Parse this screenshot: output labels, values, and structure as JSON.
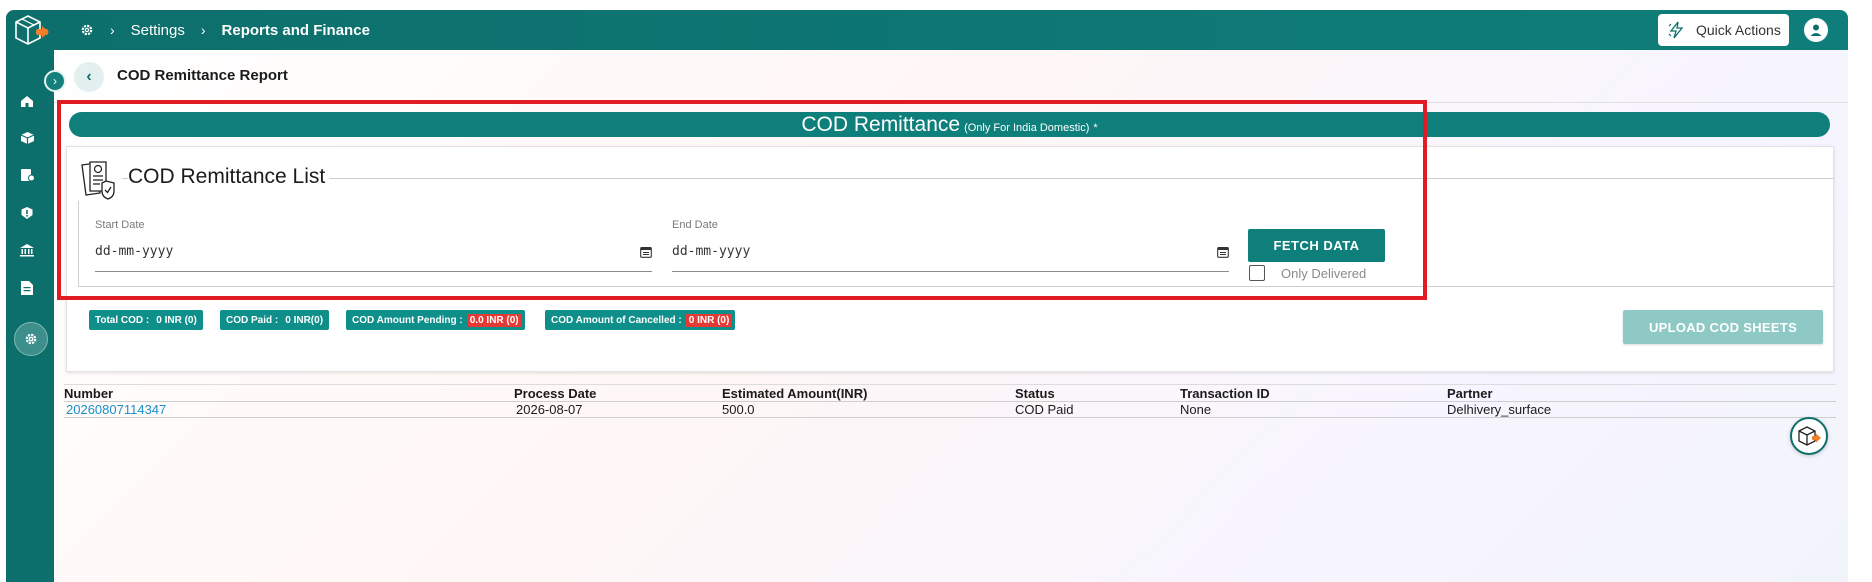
{
  "breadcrumb": {
    "separator": "›",
    "items": [
      "Settings",
      "Reports and Finance"
    ]
  },
  "header": {
    "quick_actions_label": "Quick Actions"
  },
  "sidebar": {
    "items": [
      {
        "icon": "home-icon"
      },
      {
        "icon": "box-icon"
      },
      {
        "icon": "orders-icon"
      },
      {
        "icon": "alert-icon"
      },
      {
        "icon": "bank-icon"
      },
      {
        "icon": "document-icon"
      },
      {
        "icon": "gear-icon",
        "active": true
      }
    ],
    "expand_glyph": "›"
  },
  "page": {
    "back_glyph": "‹",
    "title": "COD Remittance Report"
  },
  "banner": {
    "title": "COD Remittance",
    "subtitle": "(Only For India Domestic)",
    "asterisk": "*"
  },
  "filters": {
    "section_title": "COD Remittance List",
    "start_date_label": "Start Date",
    "start_date_value": "dd-mm-yyyy",
    "end_date_label": "End Date",
    "end_date_value": "dd-mm-yyyy",
    "fetch_label": "FETCH DATA",
    "only_delivered_label": "Only Delivered",
    "only_delivered_checked": false
  },
  "summary": {
    "total_cod_label": "Total COD :",
    "total_cod_value": "0 INR (0)",
    "cod_paid_label": "COD Paid :",
    "cod_paid_value": "0 INR(0)",
    "pending_label": "COD Amount Pending :",
    "pending_value": "0.0 INR (0)",
    "cancelled_label": "COD Amount of Cancelled :",
    "cancelled_value": "0 INR (0)"
  },
  "upload_label": "UPLOAD COD SHEETS",
  "table": {
    "columns": [
      "Number",
      "Process Date",
      "Estimated Amount(INR)",
      "Status",
      "Transaction ID",
      "Partner"
    ],
    "rows": [
      [
        "20260807114347",
        "2026-08-07",
        "500.0",
        "COD Paid",
        "None",
        "Delhivery_surface"
      ]
    ]
  },
  "colors": {
    "primary": "#0f7f7b",
    "highlight": "#e01b24",
    "badge_red": "#e53935"
  }
}
